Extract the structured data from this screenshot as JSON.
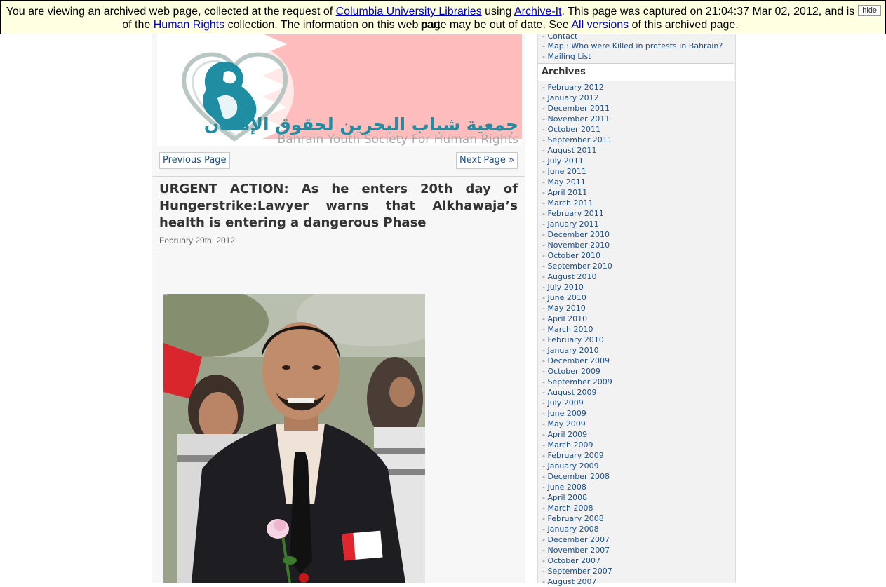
{
  "banner": {
    "text1": "You are viewing an archived web page, collected at the request of ",
    "link_columbia": "Columbia University Libraries",
    "text2": " using ",
    "link_archiveit": "Archive-It",
    "text3": ". This page was captured on 21:04:37 Mar 02, 2012, and is part",
    "text4": "of the ",
    "link_collection": "Human Rights",
    "text5": " collection. The information on this web page may be out of date. See ",
    "link_versions": "All versions",
    "text6": " of this archived page.",
    "hide_label": "hide"
  },
  "header": {
    "logo_arabic": "جمعية شباب البحرين لحقوق الإنسان",
    "logo_english": "Bahrain Youth Society For Human Rights",
    "colors": {
      "teal": "#1f8ea3",
      "flag_red": "#ffbcbc"
    }
  },
  "nav": {
    "prev_label": "Previous Page",
    "next_label": "Next Page »"
  },
  "post": {
    "title": "URGENT ACTION: As he enters 20th day of Hungerstrike:Lawyer warns that Alkhawaja’s health is entering a dangerous Phase",
    "date": "February 29th, 2012"
  },
  "sidebar": {
    "top_links": [
      {
        "dash": "- ",
        "label": "Contact"
      },
      {
        "dash": "- ",
        "label": "Map : Who were Killed in protests in Bahrain?"
      },
      {
        "dash": "- ",
        "label": "Mailing List"
      }
    ],
    "archives_title": "Archives",
    "archives": [
      "February 2012",
      "January 2012",
      "December 2011",
      "November 2011",
      "October 2011",
      "September 2011",
      "August 2011",
      "July 2011",
      "June 2011",
      "May 2011",
      "April 2011",
      "March 2011",
      "February 2011",
      "January 2011",
      "December 2010",
      "November 2010",
      "October 2010",
      "September 2010",
      "August 2010",
      "July 2010",
      "June 2010",
      "May 2010",
      "April 2010",
      "March 2010",
      "February 2010",
      "January 2010",
      "December 2009",
      "October 2009",
      "September 2009",
      "August 2009",
      "July 2009",
      "June 2009",
      "May 2009",
      "April 2009",
      "March 2009",
      "February 2009",
      "January 2009",
      "December 2008",
      "June 2008",
      "April 2008",
      "March 2008",
      "February 2008",
      "January 2008",
      "December 2007",
      "November 2007",
      "October 2007",
      "September 2007",
      "August 2007"
    ]
  }
}
